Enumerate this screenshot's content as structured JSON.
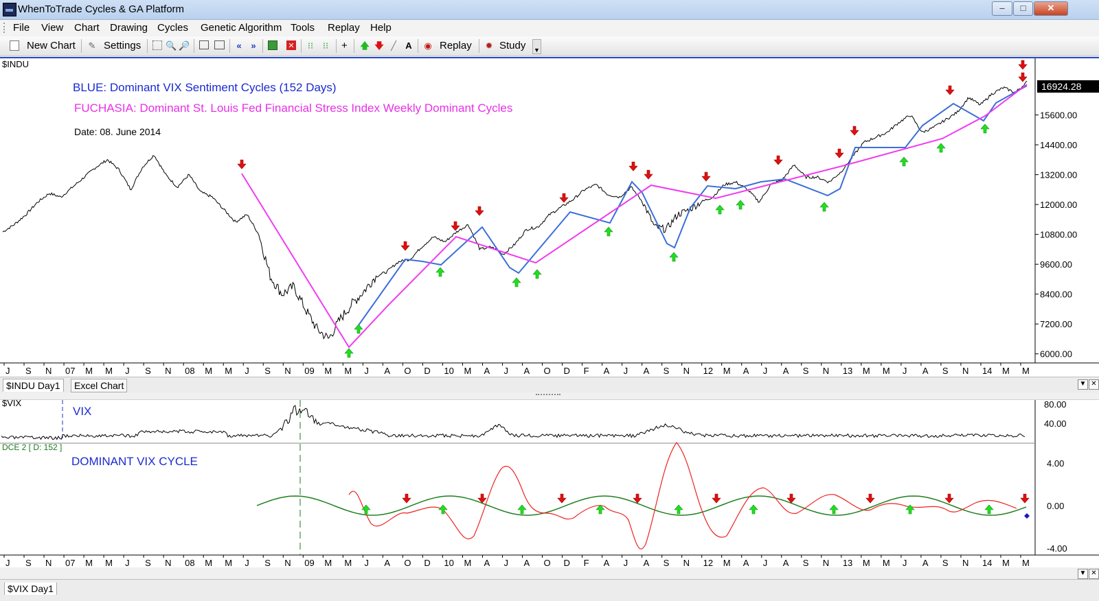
{
  "window": {
    "title": "WhenToTrade Cycles & GA Platform"
  },
  "menu": [
    "File",
    "View",
    "Chart",
    "Drawing",
    "Cycles",
    "Genetic Algorithm",
    "Tools",
    "Replay",
    "Help"
  ],
  "toolbar": {
    "new_chart": "New Chart",
    "settings": "Settings",
    "plus": "+",
    "replay": "Replay",
    "study": "Study"
  },
  "tabs": {
    "chart1": "$INDU Day1",
    "chart2": "Excel Chart",
    "bottom": "$VIX Day1"
  },
  "main_chart": {
    "symbol": "$INDU",
    "legend_blue": "BLUE: Dominant VIX Sentiment Cycles (152 Days)",
    "legend_fuchsia": "FUCHASIA: Dominant St. Louis Fed Financial Stress Index Weekly Dominant Cycles",
    "date_label": "Date: 08. June 2014",
    "last_price": "16924.28",
    "colors": {
      "blue": "#3a6fd8",
      "fuchsia": "#f03cf0",
      "price": "#000000",
      "up": "#22cc22",
      "down": "#e01010"
    }
  },
  "vix_panel": {
    "symbol": "$VIX",
    "label": "VIX",
    "yticks": [
      "80.00",
      "40.00"
    ]
  },
  "cycle_panel": {
    "indicator": "DCE 2 [ D: 152 ]",
    "label": "DOMINANT VIX CYCLE",
    "yticks": [
      "4.00",
      "0.00",
      "-4.00"
    ]
  },
  "x_axis_labels": [
    "J",
    "S",
    "N",
    "07",
    "M",
    "M",
    "J",
    "S",
    "N",
    "08",
    "M",
    "M",
    "J",
    "S",
    "N",
    "09",
    "M",
    "M",
    "J",
    "A",
    "O",
    "D",
    "10",
    "M",
    "A",
    "J",
    "A",
    "O",
    "D",
    "F",
    "A",
    "J",
    "A",
    "S",
    "N",
    "12",
    "M",
    "A",
    "J",
    "A",
    "S",
    "N",
    "13",
    "M",
    "M",
    "J",
    "A",
    "S",
    "N",
    "14",
    "M",
    "M"
  ],
  "chart_data": {
    "type": "line",
    "title": "",
    "y_ticks": [
      6000,
      7200,
      8400,
      9600,
      10800,
      12000,
      13200,
      14400,
      15600
    ],
    "ylim": [
      5800,
      17600
    ],
    "series": [
      {
        "name": "$INDU",
        "values": [
          10900,
          11200,
          11600,
          12100,
          12450,
          12300,
          12700,
          13100,
          13500,
          13800,
          13400,
          12600,
          13500,
          14000,
          13200,
          12700,
          13200,
          12500,
          12300,
          11800,
          11300,
          11600,
          10800,
          9100,
          8400,
          8700,
          7800,
          7000,
          6600,
          7400,
          8000,
          8500,
          9100,
          9300,
          9700,
          9800,
          10300,
          10700,
          10500,
          10900,
          11200,
          10200,
          10300,
          10000,
          10400,
          11000,
          11100,
          11600,
          11900,
          12200,
          12600,
          12800,
          12400,
          12300,
          12700,
          12100,
          11100,
          11000,
          11600,
          11800,
          12100,
          12300,
          12800,
          12900,
          12600,
          12100,
          12800,
          13000,
          13600,
          13100,
          13100,
          12900,
          13300,
          13900,
          14500,
          14700,
          14900,
          15300,
          15600,
          14900,
          15100,
          15400,
          15700,
          16300,
          16000,
          16450,
          16700,
          16500,
          16924
        ]
      }
    ]
  }
}
